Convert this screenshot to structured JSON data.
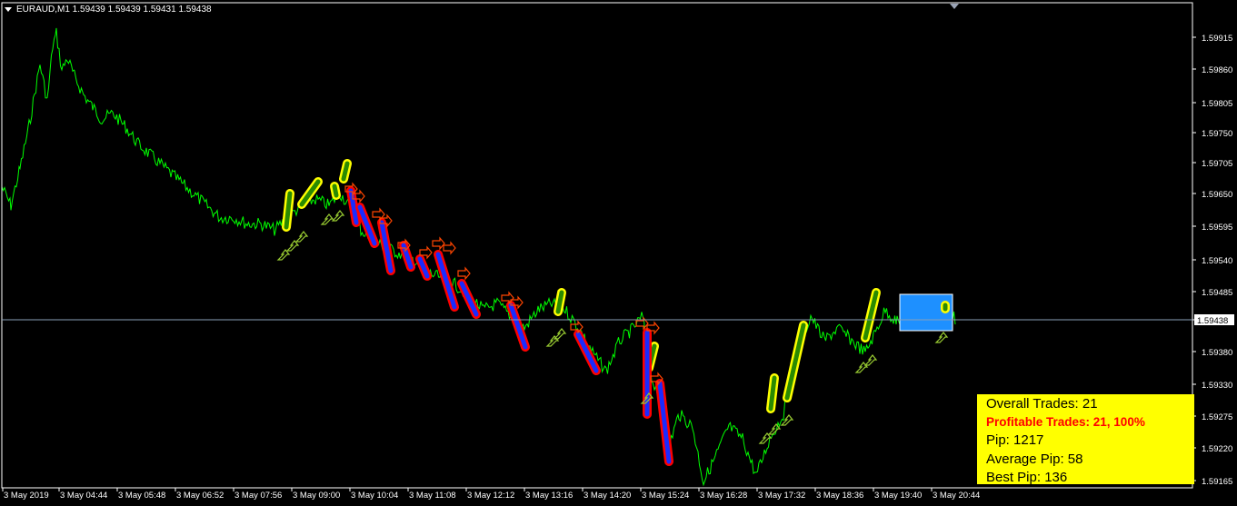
{
  "header": {
    "symbol_label": "EURAUD,M1  1.59439 1.59439 1.59431 1.59438"
  },
  "current_price_label": "1.59438",
  "colors": {
    "background": "#000000",
    "price_line": "#00ff00",
    "axis": "#ffffff",
    "buy_marker": "#ffff00",
    "sell_marker": "#ff0000",
    "sell_fill": "#1a2bff",
    "arrow_buy": "#9acd32",
    "arrow_sell": "#ff4500",
    "highlight_box": "#1e90ff",
    "stats_background": "#ffff00"
  },
  "stats": {
    "overall": "Overall Trades: 21",
    "profitable": "Profitable Trades: 21, 100%",
    "pip": "Pip: 1217",
    "average": "Average Pip: 58",
    "best": "Best Pip: 136"
  },
  "chart_data": {
    "type": "line",
    "title": "EURAUD,M1",
    "y_ticks": [
      "1.59915",
      "1.59860",
      "1.59805",
      "1.59750",
      "1.59705",
      "1.59650",
      "1.59595",
      "1.59540",
      "1.59485",
      "1.59438",
      "1.59380",
      "1.59330",
      "1.59275",
      "1.59220",
      "1.59165"
    ],
    "x_ticks": [
      "3 May 2019",
      "3 May 04:44",
      "3 May 05:48",
      "3 May 06:52",
      "3 May 07:56",
      "3 May 09:00",
      "3 May 10:04",
      "3 May 11:08",
      "3 May 12:12",
      "3 May 13:16",
      "3 May 14:20",
      "3 May 15:24",
      "3 May 16:28",
      "3 May 17:32",
      "3 May 18:36",
      "3 May 19:40",
      "3 May 20:44"
    ],
    "ylim": [
      1.5916,
      1.5995
    ],
    "current_price": 1.59438,
    "series": [
      {
        "x": [
          0,
          10,
          20,
          30,
          42,
          50,
          56,
          60,
          66,
          72,
          80,
          90,
          100,
          110,
          122,
          135,
          150,
          165,
          180,
          195,
          210,
          225,
          240,
          255,
          270,
          285,
          300,
          315,
          330,
          345,
          360,
          372,
          382,
          395,
          410,
          425,
          440,
          455,
          470,
          485,
          500,
          515,
          530,
          545,
          560,
          575,
          590,
          605,
          620,
          635,
          650,
          665,
          680,
          695,
          705,
          712,
          722,
          732,
          745,
          760,
          772,
          785,
          800,
          815,
          830,
          845,
          860,
          875,
          890,
          905,
          920,
          935,
          950,
          960,
          972,
          985,
          1000,
          1015,
          1030,
          1040,
          1050
        ],
        "y": [
          1.5965,
          1.5962,
          1.5968,
          1.5975,
          1.5985,
          1.5979,
          1.5988,
          1.599,
          1.5984,
          1.5986,
          1.5983,
          1.598,
          1.5978,
          1.5976,
          1.5977,
          1.5975,
          1.5972,
          1.597,
          1.5968,
          1.5966,
          1.5964,
          1.5962,
          1.596,
          1.596,
          1.5959,
          1.5959,
          1.5958,
          1.596,
          1.5962,
          1.5963,
          1.5962,
          1.5964,
          1.5962,
          1.5958,
          1.5956,
          1.5955,
          1.5954,
          1.5953,
          1.5951,
          1.595,
          1.5949,
          1.5947,
          1.5945,
          1.5946,
          1.5944,
          1.5942,
          1.5945,
          1.5946,
          1.5945,
          1.5942,
          1.5938,
          1.5935,
          1.594,
          1.5942,
          1.5944,
          1.5936,
          1.593,
          1.5922,
          1.5928,
          1.5926,
          1.5917,
          1.5921,
          1.5926,
          1.5924,
          1.5918,
          1.5924,
          1.5928,
          1.5938,
          1.5944,
          1.594,
          1.5942,
          1.594,
          1.5938,
          1.5941,
          1.5945,
          1.5943,
          1.5942,
          1.5945,
          1.5943,
          1.5946,
          1.5943
        ]
      }
    ]
  }
}
